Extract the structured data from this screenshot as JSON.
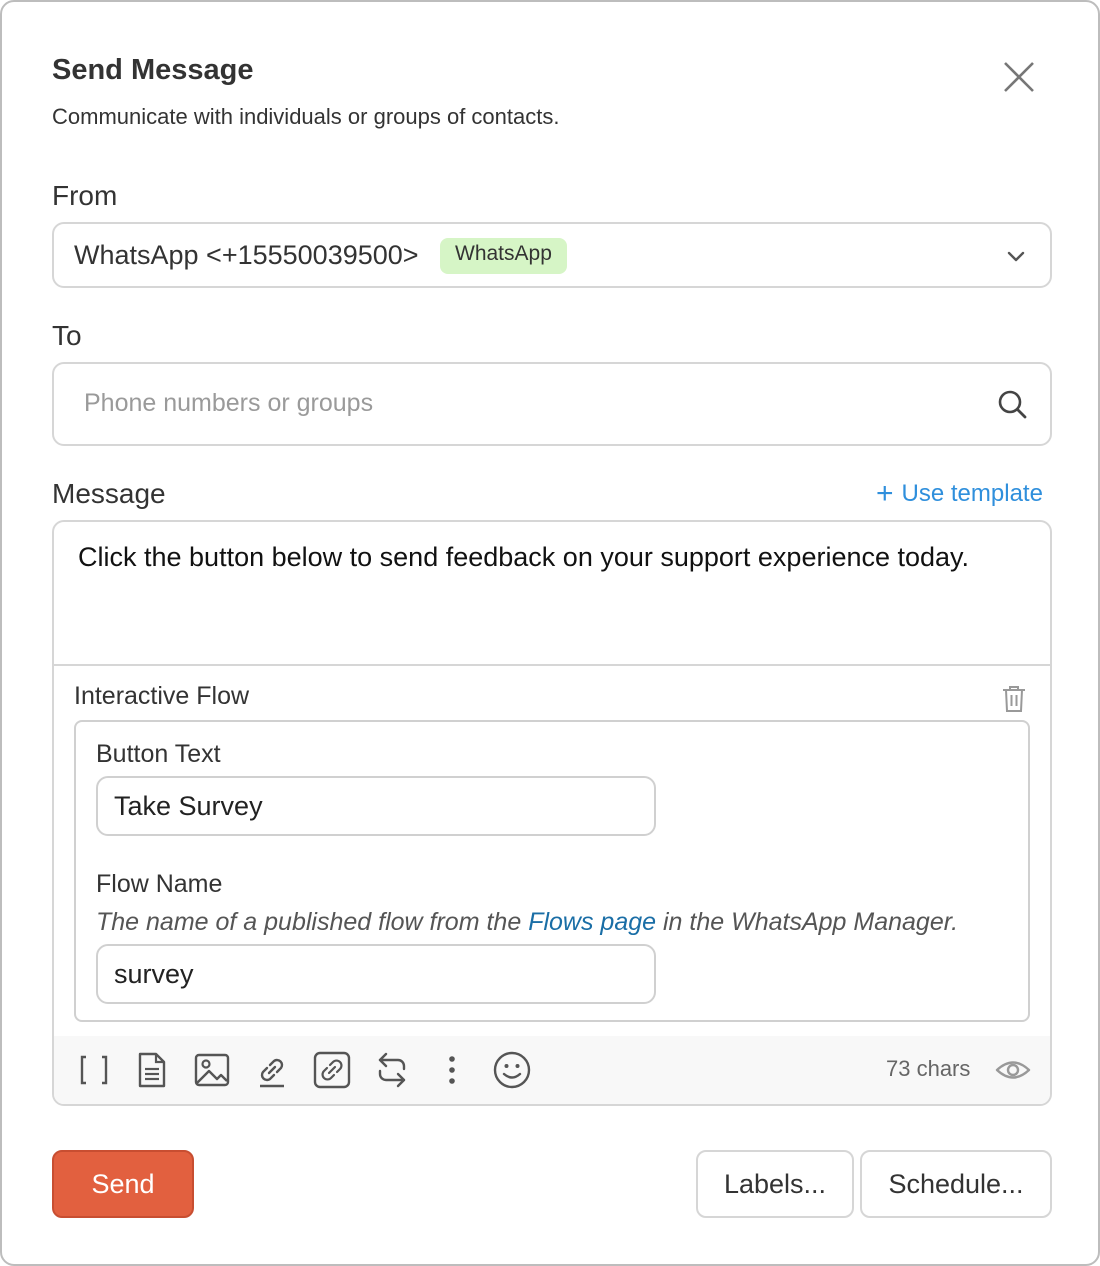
{
  "dialog": {
    "title": "Send Message",
    "subtitle": "Communicate with individuals or groups of contacts.",
    "close_icon": "close-icon"
  },
  "from": {
    "label": "From",
    "value": "WhatsApp <+15550039500>",
    "badge": "WhatsApp",
    "badge_color": "#d6f5c6"
  },
  "to": {
    "label": "To",
    "placeholder": "Phone numbers or groups"
  },
  "message": {
    "label": "Message",
    "use_template": "Use template",
    "text": "Click the button below to send feedback on your support experience today.",
    "char_count": "73 chars"
  },
  "flow": {
    "title": "Interactive Flow",
    "button_text_label": "Button Text",
    "button_text_value": "Take Survey",
    "flow_name_label": "Flow Name",
    "help_before": "The name of a published flow from the ",
    "help_link": "Flows page",
    "help_after": " in the WhatsApp Manager.",
    "flow_name_value": "survey"
  },
  "toolbar": {
    "icons": [
      "variables-icon",
      "document-icon",
      "image-icon",
      "link-icon",
      "url-button-icon",
      "quick-replies-icon",
      "more-icon",
      "emoji-icon",
      "preview-icon"
    ]
  },
  "actions": {
    "send": "Send",
    "labels": "Labels...",
    "schedule": "Schedule..."
  },
  "colors": {
    "accent": "#e2603f",
    "link": "#2f8fdc",
    "badge": "#d6f5c6"
  }
}
